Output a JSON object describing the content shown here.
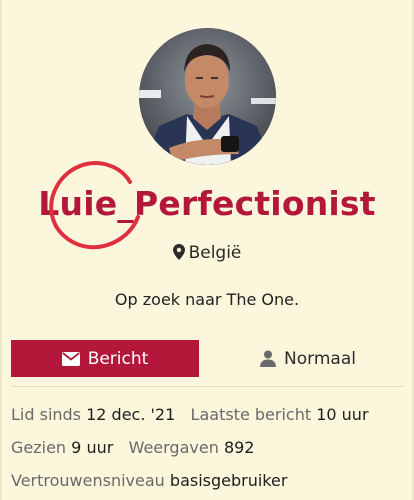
{
  "profile": {
    "username": "Luie_Perfectionist",
    "location": "België",
    "bio": "Op zoek naar The One."
  },
  "actions": {
    "message_label": "Bericht",
    "level_label": "Normaal"
  },
  "stats": {
    "member_since_label": "Lid sinds",
    "member_since_value": "12 dec. '21",
    "last_post_label": "Laatste bericht",
    "last_post_value": "10 uur",
    "seen_label": "Gezien",
    "seen_value": "9 uur",
    "views_label": "Weergaven",
    "views_value": "892",
    "trust_label": "Vertrouwensniveau",
    "trust_value": "basisgebruiker"
  },
  "icons": {
    "location": "map-pin-icon",
    "message": "envelope-icon",
    "level": "person-icon"
  },
  "colors": {
    "accent": "#b3173a",
    "background": "#fbf6dc",
    "annotation": "#e0303f"
  }
}
